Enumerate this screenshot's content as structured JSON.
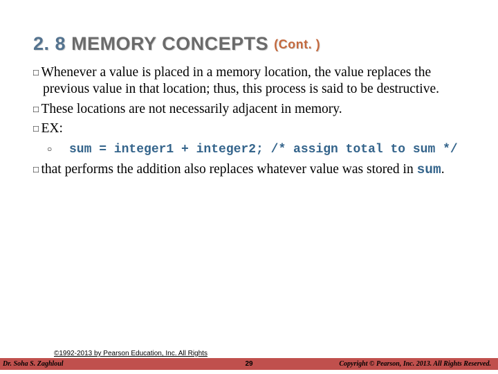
{
  "heading": {
    "number": "2. 8",
    "title": "MEMORY CONCEPTS",
    "cont": "(Cont. )"
  },
  "bullets": {
    "b1a": "Whenever a value is placed in a memory location, the value replaces the previous value in that location; thus, this process is said to be ",
    "b1b_destructive": "destructive",
    "b1c": ".",
    "b2": "These locations are not necessarily adjacent in memory.",
    "b3": "EX:",
    "code_line": "sum = integer1 + integer2; /* assign total to sum */",
    "b4a": "that performs the addition also replaces whatever value was stored in ",
    "b4b_code": "sum",
    "b4c": "."
  },
  "footer": {
    "copyright_top": "©1992-2013 by Pearson Education, Inc. All Rights",
    "author": "Dr. Soha S. Zaghloul",
    "page": "29",
    "copyright_right": "Copyright © Pearson, Inc. 2013. All Rights Reserved."
  }
}
